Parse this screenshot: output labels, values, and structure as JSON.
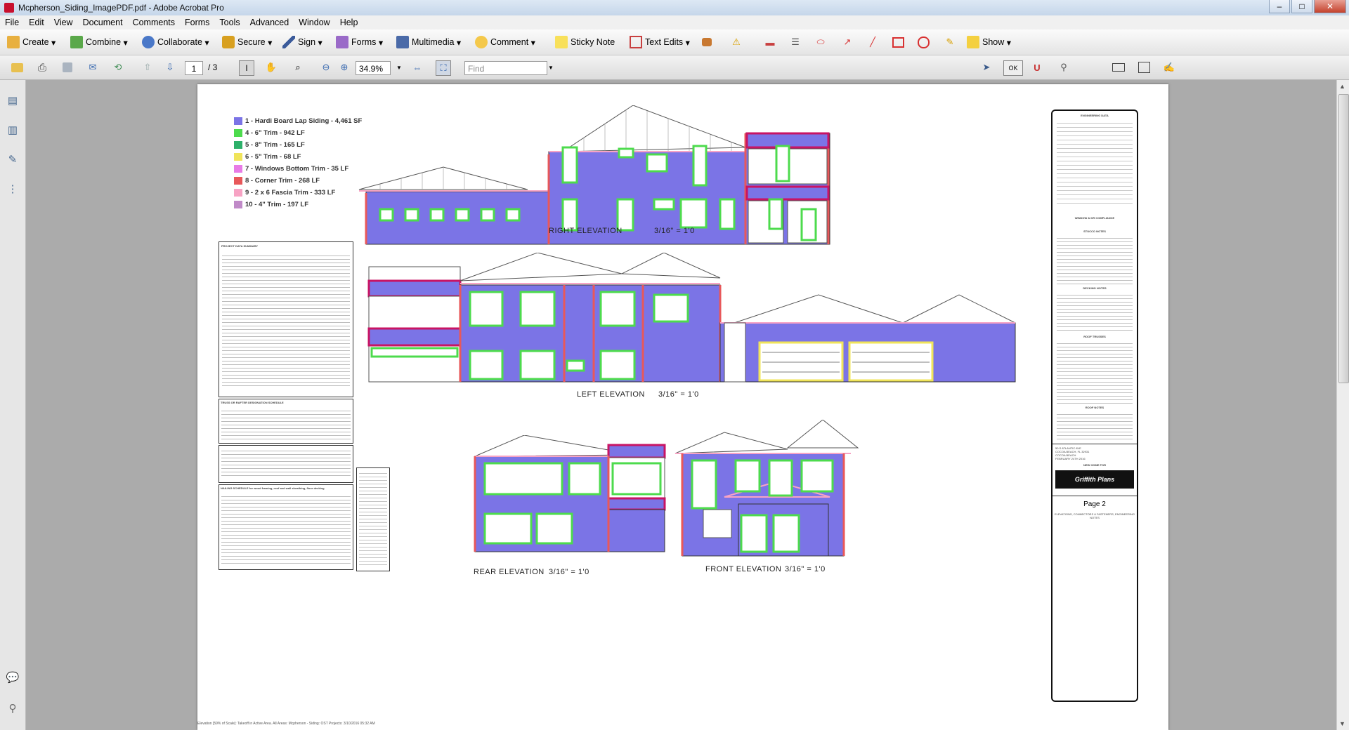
{
  "window": {
    "title": "Mcpherson_Siding_ImagePDF.pdf - Adobe Acrobat Pro"
  },
  "menu": [
    "File",
    "Edit",
    "View",
    "Document",
    "Comments",
    "Forms",
    "Tools",
    "Advanced",
    "Window",
    "Help"
  ],
  "toolbar1": {
    "create": "Create",
    "combine": "Combine",
    "collaborate": "Collaborate",
    "secure": "Secure",
    "sign": "Sign",
    "forms": "Forms",
    "multimedia": "Multimedia",
    "comment": "Comment",
    "sticky_note": "Sticky Note",
    "text_edits": "Text Edits",
    "show": "Show"
  },
  "toolbar2": {
    "current_page": "1",
    "total_pages": "/ 3",
    "zoom": "34.9%",
    "find_placeholder": "Find",
    "ok": "OK"
  },
  "legend": [
    {
      "label": "1 - Hardi Board Lap Siding - 4,461 SF",
      "color": "#7b74e6"
    },
    {
      "label": "4 - 6\" Trim - 942 LF",
      "color": "#4ddb4d"
    },
    {
      "label": "5 - 8\" Trim - 165 LF",
      "color": "#2db06a"
    },
    {
      "label": "6 - 5\" Trim - 68 LF",
      "color": "#f0e45a"
    },
    {
      "label": "7 - Windows Bottom Trim - 35 LF",
      "color": "#e87be6"
    },
    {
      "label": "8 - Corner Trim - 268 LF",
      "color": "#e8585a"
    },
    {
      "label": "9 - 2 x 6 Fascia Trim - 333 LF",
      "color": "#f7a3c4"
    },
    {
      "label": "10 - 4\" Trim - 197 LF",
      "color": "#c08ac8"
    }
  ],
  "elevations": {
    "right": "RIGHT ELEVATION",
    "right_scale": "3/16\" = 1'0",
    "left": "LEFT ELEVATION",
    "left_scale": "3/16\" = 1'0",
    "rear": "REAR ELEVATION",
    "rear_scale": "3/16\" = 1'0",
    "front": "FRONT  ELEVATION",
    "front_scale": "3/16\" = 1'0"
  },
  "notes": {
    "project_data": "PROJECT DATA SUMMARY",
    "truss": "TRUSS OR RAFTER DESIGNATION SCHEDULE",
    "nailing": "NAILING SCHEDULE for wood framing, roof and wall sheathing, floor decking"
  },
  "titleblock": {
    "heading": "ENGINEERING DATA",
    "window": "WINDOW & DR COMPLIANCE",
    "stucco": "STUCCO NOTES",
    "decking": "DECKING NOTES",
    "roof_truss": "ROOF TRUSSES",
    "roof_notes": "ROOF NOTES",
    "address": "50 S ATLANTIC AVE",
    "city": "COCOA BEACH, FL 32931",
    "subdiv": "COCOA BEACH",
    "date": "FEBRUARY 24TH 2016",
    "new_home": "NEW HOME FOR",
    "brand": "Griffith Plans",
    "page": "Page 2",
    "footer": "ELEVATIONS, CONNECTORS & FASTENERS, ENGINEERING NOTES"
  },
  "footer_note": "Elevation [59% of Scale]: Takeoff in Active Area. All Areas: Mcpherson - Siding: OST Projects: 3/10/2016 05:32 AM"
}
